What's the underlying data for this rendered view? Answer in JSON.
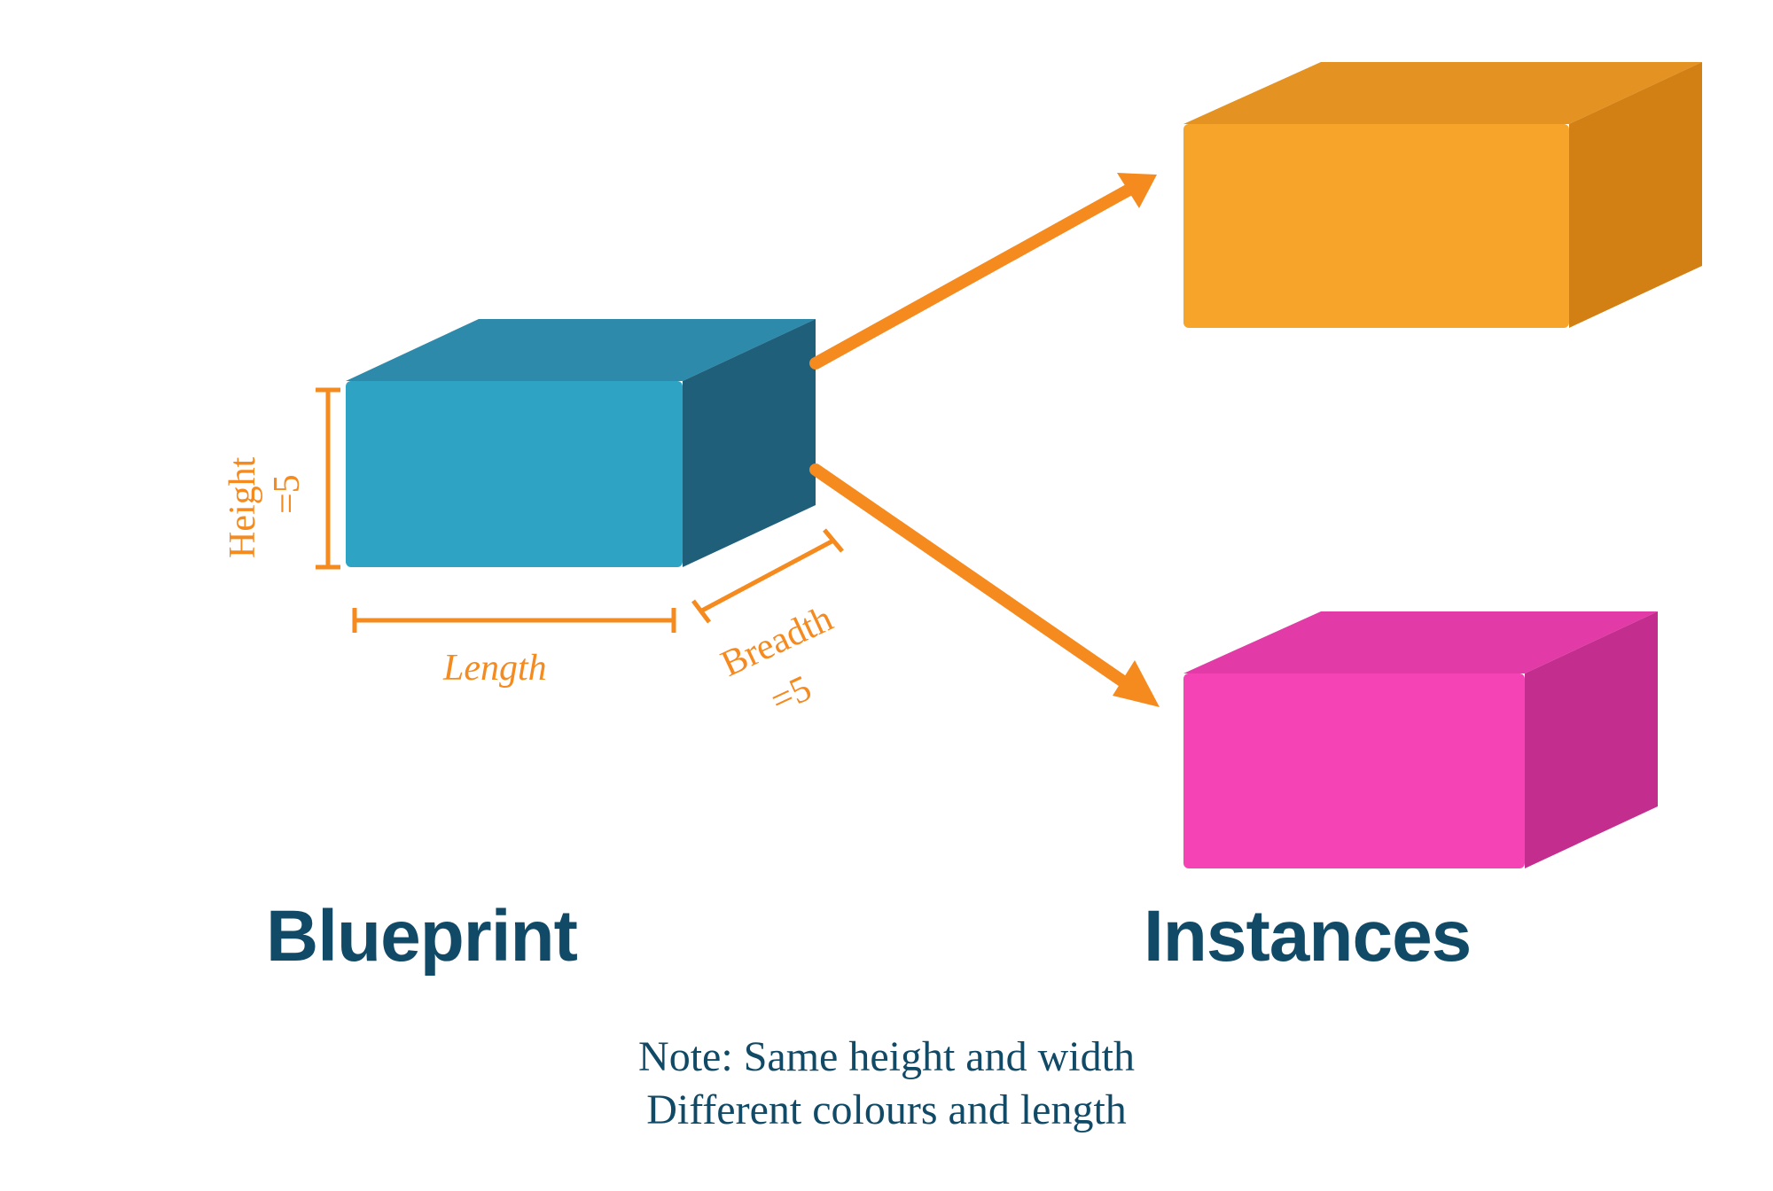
{
  "headings": {
    "left": "Blueprint",
    "right": "Instances"
  },
  "note": {
    "line1": "Note: Same height and width",
    "line2": "Different colours and length"
  },
  "dimensions": {
    "height_label": "Height",
    "height_value": "=5",
    "length_label": "Length",
    "breadth_label": "Breadth",
    "breadth_value": "=5"
  },
  "colors": {
    "blueprint_front": "#2fa3c4",
    "blueprint_top": "#2d8aaa",
    "blueprint_side": "#1f5f7a",
    "instance1_front": "#f6a52a",
    "instance1_top": "#e49222",
    "instance1_side": "#d27f14",
    "instance2_front": "#f542b5",
    "instance2_top": "#e23aa6",
    "instance2_side": "#c22d8e",
    "arrow": "#f58a1f",
    "heading": "#114a66",
    "dim": "#f58a1f"
  }
}
